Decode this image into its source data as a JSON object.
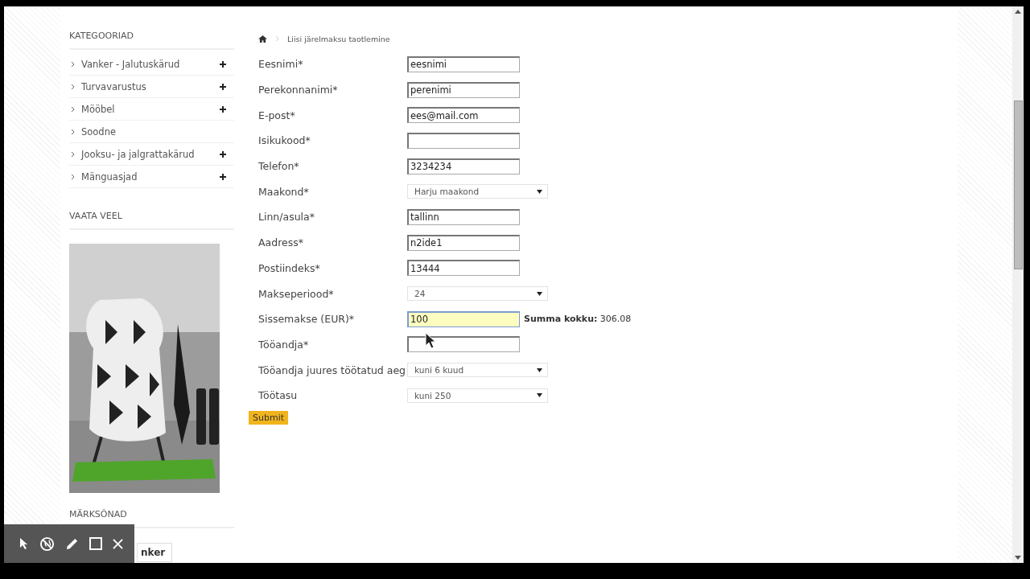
{
  "sidebar": {
    "categories_title": "KATEGOORIAD",
    "categories": [
      {
        "label": "Vanker - Jalutuskärud",
        "expandable": true
      },
      {
        "label": "Turvavarustus",
        "expandable": true
      },
      {
        "label": "Mööbel",
        "expandable": true
      },
      {
        "label": "Soodne",
        "expandable": false
      },
      {
        "label": "Jooksu- ja jalgrattakärud",
        "expandable": true
      },
      {
        "label": "Mänguasjad",
        "expandable": true
      }
    ],
    "more_title": "VAATA VEEL",
    "tags_title": "MÄRKSÕNAD",
    "tags": [
      "nker"
    ]
  },
  "breadcrumb": {
    "current": "Liisi järelmaksu taotlemine"
  },
  "form": {
    "fields": [
      {
        "label": "Eesnimi*",
        "kind": "text",
        "value": "eesnimi",
        "focused": false
      },
      {
        "label": "Perekonnanimi*",
        "kind": "text",
        "value": "perenimi",
        "focused": false
      },
      {
        "label": "E-post*",
        "kind": "text",
        "value": "ees@mail.com",
        "focused": false
      },
      {
        "label": "Isikukood*",
        "kind": "text",
        "focused": false
      },
      {
        "label": "Telefon*",
        "kind": "text",
        "value": "3234234",
        "focused": false
      },
      {
        "label": "Maakond*",
        "kind": "select",
        "value": "Harju maakond"
      },
      {
        "label": "Linn/asula*",
        "kind": "text",
        "value": "tallinn",
        "focused": false
      },
      {
        "label": "Aadress*",
        "kind": "text",
        "value": "n2ide1",
        "focused": false
      },
      {
        "label": "Postiindeks*",
        "kind": "text",
        "value": "13444",
        "focused": false
      },
      {
        "label": "Makseperiood*",
        "kind": "select",
        "value": "24"
      },
      {
        "label": "Sissemakse (EUR)*",
        "kind": "text",
        "value": "100",
        "focused": true,
        "note": "**Summa kokku:** 306.08"
      },
      {
        "label": "Tööandja*",
        "kind": "text",
        "focused": false
      },
      {
        "label": "Tööandja juures töötatud aeg",
        "kind": "select",
        "value": "kuni 6 kuud"
      },
      {
        "label": "Töötasu",
        "kind": "select",
        "value": "kuni 250"
      }
    ],
    "submit": "Submit"
  }
}
